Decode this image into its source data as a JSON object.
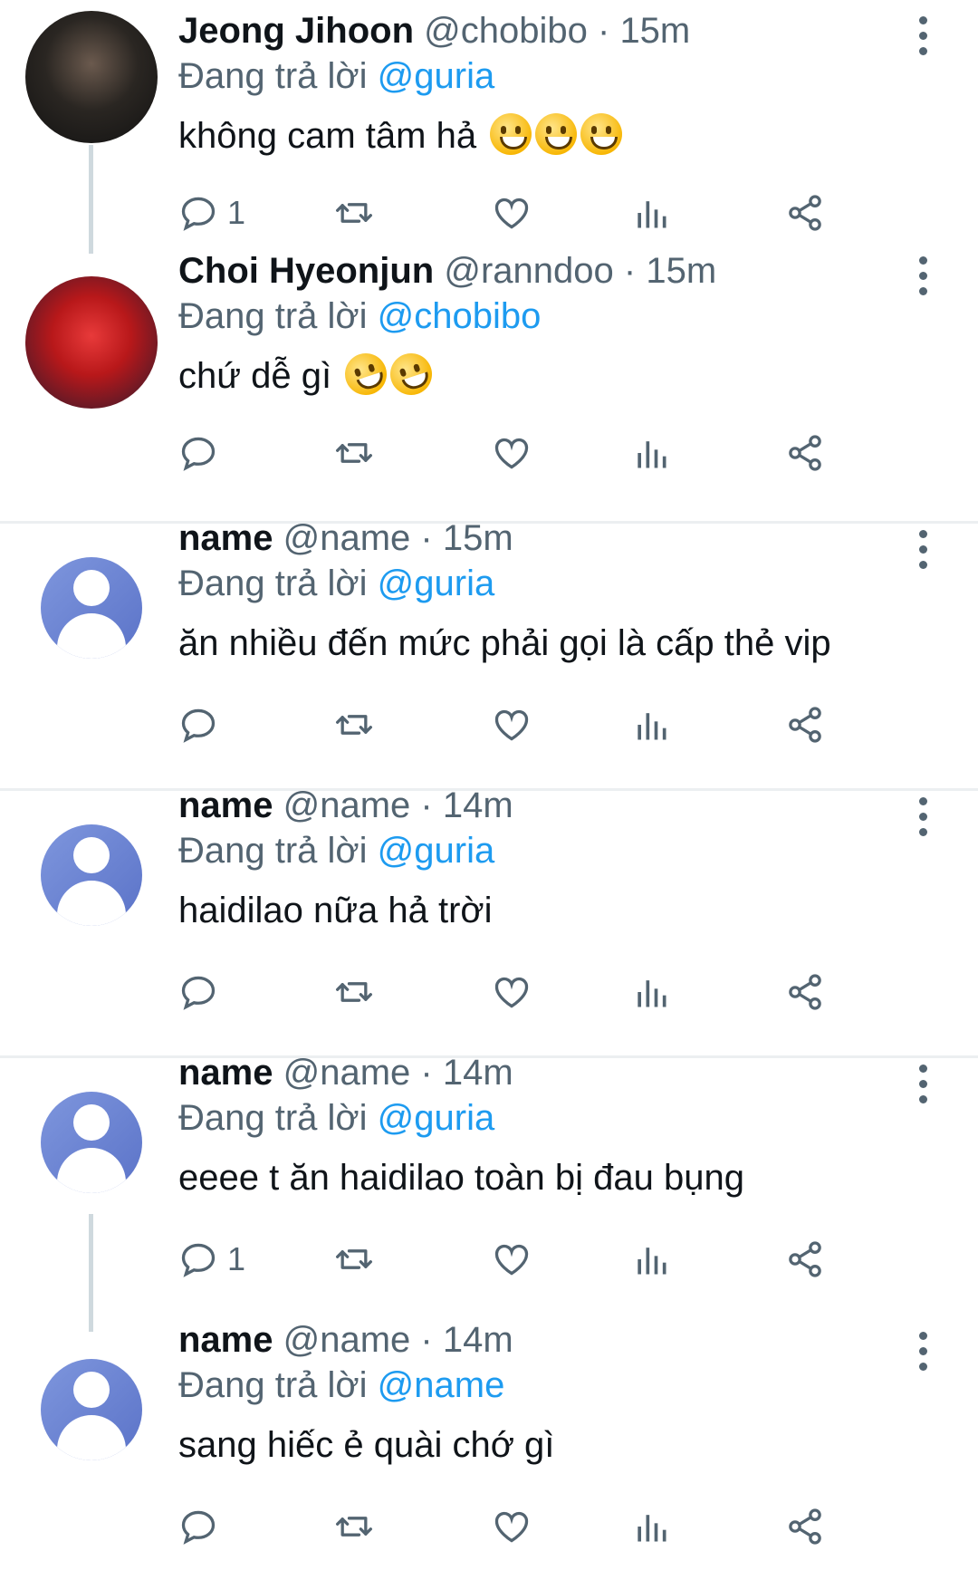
{
  "replying_label": "Đang trả lời",
  "tweets": [
    {
      "name": "Jeong Jihoon",
      "handle": "@chobibo",
      "sep": "·",
      "time": "15m",
      "reply_to": "@guria",
      "text": "không cam tâm hả",
      "reply_count": "1"
    },
    {
      "name": "Choi Hyeonjun",
      "handle": "@ranndoo",
      "sep": "·",
      "time": "15m",
      "reply_to": "@chobibo",
      "text": "chứ dễ gì",
      "reply_count": ""
    },
    {
      "name": "name",
      "handle": "@name",
      "sep": "·",
      "time": "15m",
      "reply_to": "@guria",
      "text": "ăn nhiều đến mức phải gọi là cấp thẻ vip",
      "reply_count": ""
    },
    {
      "name": "name",
      "handle": "@name",
      "sep": "·",
      "time": "14m",
      "reply_to": "@guria",
      "text": "haidilao nữa hả trời",
      "reply_count": ""
    },
    {
      "name": "name",
      "handle": "@name",
      "sep": "·",
      "time": "14m",
      "reply_to": "@guria",
      "text": "eeee t ăn haidilao toàn bị đau bụng",
      "reply_count": "1"
    },
    {
      "name": "name",
      "handle": "@name",
      "sep": "·",
      "time": "14m",
      "reply_to": "@name",
      "text": "sang hiếc ẻ quài chớ gì",
      "reply_count": ""
    }
  ],
  "icons": {
    "reply": "reply-icon",
    "retweet": "retweet-icon",
    "like": "heart-icon",
    "views": "views-icon",
    "share": "share-icon",
    "more": "more-options-icon",
    "emoji_grin": "grinning-face-emoji",
    "emoji_laugh": "rolling-laughing-emoji"
  },
  "colors": {
    "mention": "#1d9bf0",
    "secondary": "#536471",
    "primary": "#0f1419"
  }
}
